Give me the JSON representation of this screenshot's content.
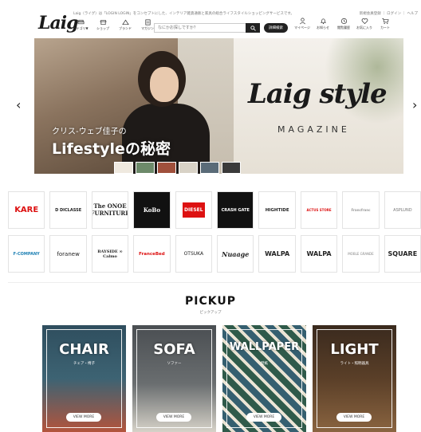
{
  "header": {
    "logo": "Laig",
    "tagline": "Laig（ライグ）は「LOGIN LOGIN」をコンセプトにした、インテリア雑貨通販と家具の総合ライフスタイルショッピングサービスです。",
    "top_links": "新規会員登録 ｜ ログイン ｜ ヘルプ",
    "nav": [
      {
        "label": "カテゴリ▼",
        "icon": "sofa-icon"
      },
      {
        "label": "ショップ",
        "icon": "shop-icon"
      },
      {
        "label": "ブランド",
        "icon": "brand-icon"
      },
      {
        "label": "マガジン",
        "icon": "magazine-icon"
      }
    ],
    "search_placeholder": "なにかお探しですか？",
    "detail_search": "詳細検索",
    "user_icons": [
      {
        "label": "マイページ",
        "icon": "user-icon"
      },
      {
        "label": "お知らせ",
        "icon": "bell-icon"
      },
      {
        "label": "閲覧履歴",
        "icon": "history-icon"
      },
      {
        "label": "お気に入り",
        "icon": "heart-icon"
      },
      {
        "label": "カート",
        "icon": "cart-icon"
      }
    ]
  },
  "hero": {
    "subtitle": "クリス-ウェブ佳子の",
    "title": "Lifestyleの秘密",
    "brand": "Laig style",
    "brand_sub": "MAGAZINE",
    "prev": "‹",
    "next": "›"
  },
  "brands": {
    "row1": [
      "KARE",
      "D DICLASSE",
      "The ONOE FURNITURE",
      "KoBo",
      "DIESEL",
      "CRASH GATE",
      "HIGHTIDE",
      "ACTUS STORE",
      "Francfranc",
      "ASPLUND"
    ],
    "row2": [
      "F-COMPANY",
      "foranew",
      "BAYSIDE ∞ Calmo",
      "FranceBed",
      "OTSUKA",
      "Nuaage",
      "WALPA",
      "WALPA",
      "MOBLE GRANDE",
      "SQUARE"
    ]
  },
  "pickup": {
    "title": "PICKUP",
    "subtitle": "ピックアップ",
    "cards": [
      {
        "title": "CHAIR",
        "sub": "チェア・椅子",
        "button": "VIEW MORE"
      },
      {
        "title": "SOFA",
        "sub": "ソファー",
        "button": "VIEW MORE"
      },
      {
        "title": "WALLPAPER",
        "sub": "壁紙",
        "button": "VIEW MORE"
      },
      {
        "title": "LIGHT",
        "sub": "ライト・照明器具",
        "button": "VIEW MORE"
      }
    ]
  },
  "colors": {
    "accent_dark": "#222222",
    "diesel_red": "#d11111"
  }
}
